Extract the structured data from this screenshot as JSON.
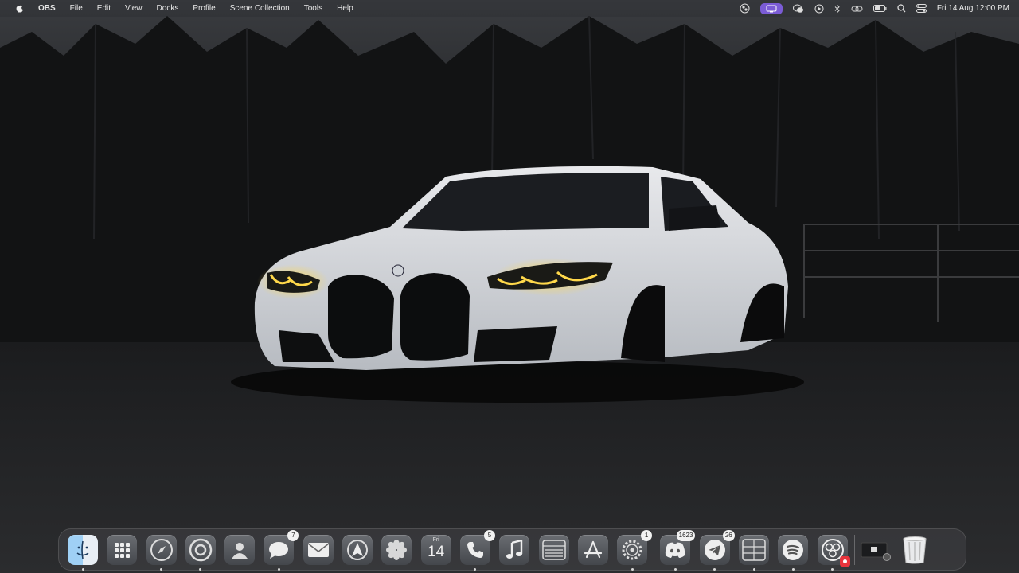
{
  "menubar": {
    "apple_icon": "apple-logo-icon",
    "app_name": "OBS",
    "menus": [
      "File",
      "Edit",
      "View",
      "Docks",
      "Profile",
      "Scene Collection",
      "Tools",
      "Help"
    ],
    "status_icons": [
      "obs-status-icon",
      "screen-mirror-icon",
      "wechat-icon",
      "play-icon",
      "bluetooth-icon",
      "link-icon",
      "battery-icon",
      "search-icon",
      "control-center-icon"
    ],
    "clock": "Fri 14 Aug  12:00 PM",
    "accent": "#7b5cd6"
  },
  "dock": {
    "apps": [
      {
        "name": "Finder",
        "icon": "finder-icon",
        "running": true
      },
      {
        "name": "Launchpad",
        "icon": "launchpad-icon",
        "running": false
      },
      {
        "name": "Safari",
        "icon": "safari-icon",
        "running": true
      },
      {
        "name": "Chrome",
        "icon": "chrome-icon",
        "running": true
      },
      {
        "name": "Contacts",
        "icon": "contacts-icon",
        "running": false
      },
      {
        "name": "Messages",
        "icon": "messages-icon",
        "badge": "7",
        "running": true
      },
      {
        "name": "Mail",
        "icon": "mail-icon",
        "running": false
      },
      {
        "name": "Maps",
        "icon": "maps-icon",
        "running": false
      },
      {
        "name": "Photos",
        "icon": "photos-icon",
        "running": false
      },
      {
        "name": "Calendar",
        "icon": "calendar-icon",
        "day": "Fri",
        "date": "14",
        "running": false
      },
      {
        "name": "Phone",
        "icon": "phone-icon",
        "badge": "5",
        "running": true
      },
      {
        "name": "Music",
        "icon": "music-icon",
        "running": false
      },
      {
        "name": "Notes",
        "icon": "notes-icon",
        "running": false
      },
      {
        "name": "App Store",
        "icon": "app-store-icon",
        "running": false
      },
      {
        "name": "System Settings",
        "icon": "gear-icon",
        "badge": "1",
        "running": true
      },
      {
        "name": "Discord",
        "icon": "discord-icon",
        "badge": "1623",
        "running": true
      },
      {
        "name": "Telegram",
        "icon": "telegram-icon",
        "badge": "26",
        "running": true
      },
      {
        "name": "Grid App",
        "icon": "grid-icon",
        "running": true
      },
      {
        "name": "Spotify",
        "icon": "spotify-icon",
        "running": true
      },
      {
        "name": "OBS",
        "icon": "obs-icon",
        "running": true
      },
      {
        "name": "Screenshot",
        "icon": "screenshot-folder-icon",
        "running": false
      },
      {
        "name": "Trash",
        "icon": "trash-icon",
        "running": false
      }
    ]
  }
}
